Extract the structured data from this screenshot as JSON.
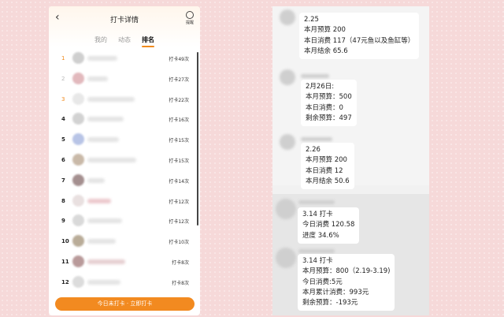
{
  "header": {
    "back_icon": "back-chevron-icon",
    "title": "打卡详情",
    "remind_label": "提醒",
    "remind_icon": "alarm-clock-icon"
  },
  "tabs": [
    {
      "label": "我的",
      "active": false
    },
    {
      "label": "动态",
      "active": false
    },
    {
      "label": "排名",
      "active": true
    }
  ],
  "ranking": [
    {
      "rank": "1",
      "count": "打卡49次"
    },
    {
      "rank": "2",
      "count": "打卡27次"
    },
    {
      "rank": "3",
      "count": "打卡22次"
    },
    {
      "rank": "4",
      "count": "打卡16次"
    },
    {
      "rank": "5",
      "count": "打卡15次"
    },
    {
      "rank": "6",
      "count": "打卡15次"
    },
    {
      "rank": "7",
      "count": "打卡14次"
    },
    {
      "rank": "8",
      "count": "打卡12次"
    },
    {
      "rank": "9",
      "count": "打卡12次"
    },
    {
      "rank": "10",
      "count": "打卡10次"
    },
    {
      "rank": "11",
      "count": "打卡8次"
    },
    {
      "rank": "12",
      "count": "打卡8次"
    }
  ],
  "cta_label": "今日未打卡 · 立即打卡",
  "messages": [
    {
      "lines": [
        "2.25",
        "本月预算 200",
        "本日消费 117（47元鱼以及鱼缸等）",
        "本月结余 65.6"
      ]
    },
    {
      "lines": [
        "2月26日:",
        "本月预算：500",
        "本日消费：0",
        "剩余预算：497"
      ]
    },
    {
      "lines": [
        "2.26",
        "本月预算 200",
        "本日消费 12",
        "本月结余 50.6"
      ]
    },
    {
      "lines": [
        "3.14 打卡",
        "今日消费 120.58",
        "进度 34.6%"
      ]
    },
    {
      "lines": [
        "3.14 打卡",
        "本月预算：800（2.19-3.19)",
        "今日消费:5元",
        "本月累计消费：993元",
        "剩余预算：-193元"
      ]
    }
  ],
  "colors": {
    "accent": "#f28a20",
    "background": "#f6d9d9"
  }
}
